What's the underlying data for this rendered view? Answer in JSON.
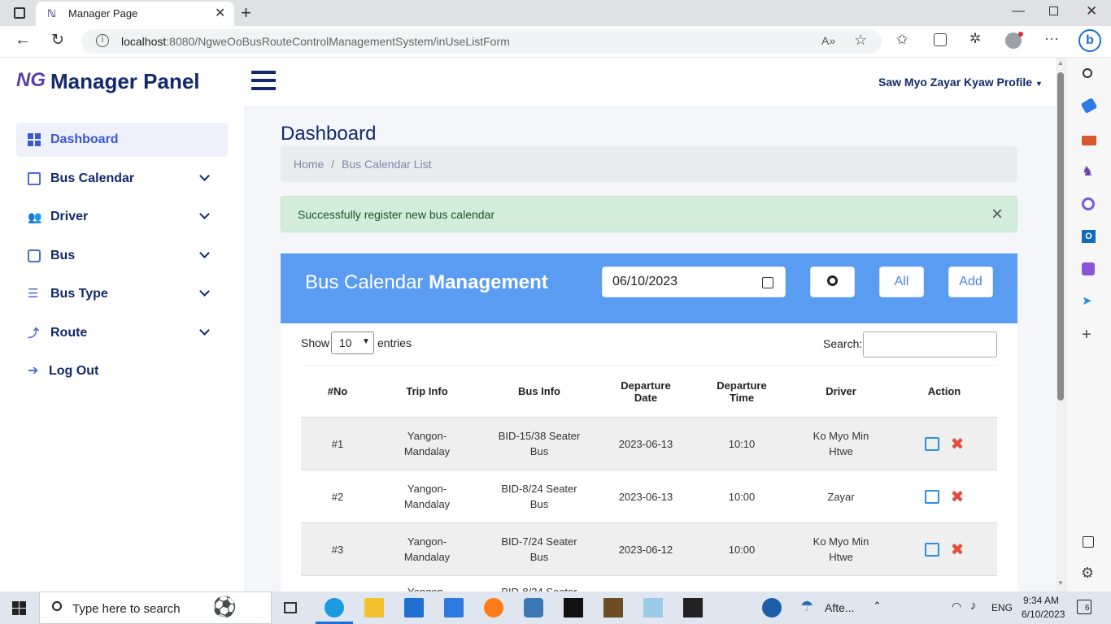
{
  "browser": {
    "tab_title": "Manager Page",
    "url_host": "localhost",
    "url_rest": ":8080/NgweOoBusRouteControlManagementSystem/inUseListForm"
  },
  "header": {
    "brand_logo": "NG",
    "brand_title": "Manager Panel",
    "profile_label": "Saw Myo Zayar Kyaw Profile"
  },
  "sidebar": {
    "items": [
      {
        "label": "Dashboard",
        "icon": "grid-icon"
      },
      {
        "label": "Bus Calendar",
        "icon": "calendar-icon"
      },
      {
        "label": "Driver",
        "icon": "users-icon"
      },
      {
        "label": "Bus",
        "icon": "bus-icon"
      },
      {
        "label": "Bus Type",
        "icon": "list-icon"
      },
      {
        "label": "Route",
        "icon": "route-icon"
      },
      {
        "label": "Log Out",
        "icon": "arrow-right-icon"
      }
    ]
  },
  "main": {
    "page_title": "Dashboard",
    "breadcrumb": {
      "home": "Home",
      "sep": "/",
      "current": "Bus Calendar List"
    },
    "alert": {
      "message": "Successfully register new bus calendar",
      "close": "×"
    },
    "card": {
      "title_light": "Bus Calendar",
      "title_bold": "Management",
      "date_value": "06/10/2023",
      "all_label": "All",
      "add_label": "Add"
    },
    "table_controls": {
      "show": "Show",
      "entries_value": "10",
      "entries": "entries",
      "search": "Search:"
    },
    "columns": [
      "#No",
      "Trip Info",
      "Bus Info",
      "Departure Date",
      "Departure Time",
      "Driver",
      "Action"
    ],
    "rows": [
      {
        "no": "#1",
        "trip": "Yangon-Mandalay",
        "bus": "BID-15/38 Seater Bus",
        "date": "2023-06-13",
        "time": "10:10",
        "driver": "Ko Myo Min Htwe"
      },
      {
        "no": "#2",
        "trip": "Yangon-Mandalay",
        "bus": "BID-8/24 Seater Bus",
        "date": "2023-06-13",
        "time": "10:00",
        "driver": "Zayar"
      },
      {
        "no": "#3",
        "trip": "Yangon-Mandalay",
        "bus": "BID-7/24 Seater Bus",
        "date": "2023-06-12",
        "time": "10:00",
        "driver": "Ko Myo Min Htwe"
      },
      {
        "no": "",
        "trip": "Yangon-",
        "bus": "BID-8/24 Seater",
        "date": "",
        "time": "",
        "driver": ""
      }
    ]
  },
  "taskbar": {
    "search_placeholder": "Type here to search",
    "weather": "Afte...",
    "lang": "ENG",
    "time": "9:34 AM",
    "date": "6/10/2023",
    "notifications": "6"
  }
}
